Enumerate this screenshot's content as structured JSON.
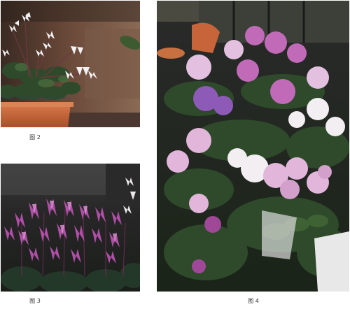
{
  "figures": [
    {
      "caption": "图 2"
    },
    {
      "caption": "图 3"
    },
    {
      "caption": "图 4"
    }
  ],
  "colors": {
    "background": "#ffffff",
    "pot_terracotta": "#c8643a",
    "leaf_green": "#2e4a2a",
    "white_petal": "#f4f1f3",
    "pink_petal": "#d7a3cf",
    "magenta_petal": "#b14fa8",
    "purple_petal": "#8e5ab8"
  }
}
